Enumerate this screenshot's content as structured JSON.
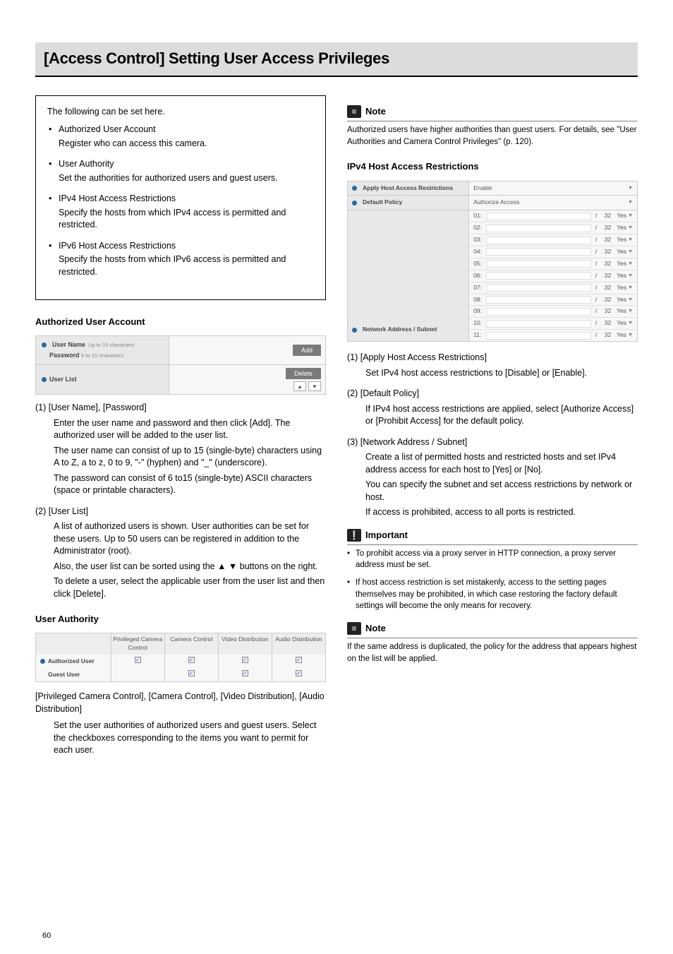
{
  "title": "[Access Control] Setting User Access Privileges",
  "intro": {
    "lead": "The following can be set here.",
    "items": [
      {
        "head": "Authorized User Account",
        "desc": "Register who can access this camera."
      },
      {
        "head": "User Authority",
        "desc": "Set the authorities for authorized users and guest users."
      },
      {
        "head": "IPv4 Host Access Restrictions",
        "desc": "Specify the hosts from which IPv4 access is permitted and restricted."
      },
      {
        "head": "IPv6 Host Access Restrictions",
        "desc": "Specify the hosts from which IPv6 access is permitted and restricted."
      }
    ]
  },
  "authorized_user_account": {
    "heading": "Authorized User Account",
    "ss": {
      "user_name_label": "User Name",
      "user_name_hint": "Up to 15 characters",
      "password_label": "Password",
      "password_hint": "6 to 15 characters",
      "add_btn": "Add",
      "user_list_label": "User List",
      "delete_btn": "Delete",
      "up": "▲",
      "down": "▼"
    },
    "items": [
      {
        "title": "(1) [User Name], [Password]",
        "paras": [
          "Enter the user name and password and then click [Add]. The authorized user will be added to the user list.",
          "The user name can consist of up to 15 (single-byte) characters using A to Z, a to z, 0 to 9, \"-\" (hyphen) and \"_\" (underscore).",
          "The password can consist of 6 to15 (single-byte) ASCII characters (space or printable characters)."
        ]
      },
      {
        "title": "(2) [User List]",
        "paras": [
          "A list of authorized users is shown. User authorities can be set for these users. Up to 50 users can be registered in addition to the Administrator (root).",
          "Also, the user list can be sorted using the ▲ ▼ buttons on the right.",
          "To delete a user, select the applicable user from the user list and then click [Delete]."
        ]
      }
    ]
  },
  "user_authority": {
    "heading": "User Authority",
    "ss": {
      "cols": [
        "Privileged Camera Control",
        "Camera Control",
        "Video Distribution",
        "Audio Distribution"
      ],
      "rows": [
        {
          "label": "Authorized User",
          "checks": [
            true,
            true,
            true,
            true
          ]
        },
        {
          "label": "Guest User",
          "checks": [
            false,
            true,
            true,
            true
          ]
        }
      ]
    },
    "item_title": "[Privileged Camera Control], [Camera Control], [Video Distribution], [Audio Distribution]",
    "item_body": "Set the user authorities of authorized users and guest users. Select the checkboxes corresponding to the items you want to permit for each user."
  },
  "note1": {
    "label": "Note",
    "text": "Authorized users have higher authorities than guest users. For details, see \"User Authorities and Camera Control Privileges\" (p. 120)."
  },
  "ipv4": {
    "heading": "IPv4 Host Access Restrictions",
    "ss": {
      "row1_label": "Apply Host Access Restrictions",
      "row1_value": "Enable",
      "row2_label": "Default Policy",
      "row2_value": "Authorize Access",
      "left_label": "Network Address / Subnet",
      "subnet": "32",
      "yes": "Yes",
      "indices": [
        "01:",
        "02:",
        "03:",
        "04:",
        "05:",
        "06:",
        "07:",
        "08:",
        "09:",
        "10:",
        "11:"
      ]
    },
    "items": [
      {
        "title": "(1) [Apply Host Access Restrictions]",
        "paras": [
          "Set IPv4 host access restrictions to [Disable] or [Enable]."
        ]
      },
      {
        "title": "(2) [Default Policy]",
        "paras": [
          "If IPv4 host access restrictions are applied, select [Authorize Access] or [Prohibit Access] for the default policy."
        ]
      },
      {
        "title": "(3) [Network Address / Subnet]",
        "paras": [
          "Create a list of permitted hosts and restricted hosts and set IPv4 address access for each host to [Yes] or [No].",
          "You can specify the subnet and set access restrictions by network or host.",
          "If access is prohibited, access to all ports is restricted."
        ]
      }
    ]
  },
  "important": {
    "label": "Important",
    "bullets": [
      "To prohibit access via a proxy server in HTTP connection, a proxy server address must be set.",
      "If host access restriction is set mistakenly, access to the setting pages themselves may be prohibited, in which case restoring the factory default settings will become the only means for recovery."
    ]
  },
  "note2": {
    "label": "Note",
    "text": "If the same address is duplicated, the policy for the address that appears highest on the list will be applied."
  },
  "page_number": "60"
}
